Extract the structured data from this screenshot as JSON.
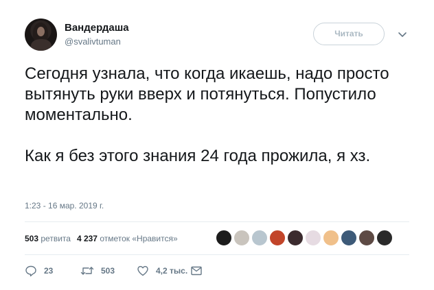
{
  "author": {
    "display_name": "Вандердаша",
    "handle": "@svalivtuman"
  },
  "follow_button": {
    "label": "Читать"
  },
  "tweet": {
    "paragraphs": [
      "Сегодня узнала, что когда икаешь, надо просто вытянуть руки вверх и потянуться. Попустило моментально.",
      "Как я без этого знания 24 года прожила, я хз."
    ],
    "timestamp": "1:23 - 16 мар. 2019 г."
  },
  "stats": {
    "retweets_count": "503",
    "retweets_label": "ретвита",
    "likes_count": "4 237",
    "likes_label": "отметок «Нравится»"
  },
  "likers": {
    "avatar_colors": [
      "#1c1c1c",
      "#c9c4bd",
      "#b8c6cf",
      "#c2452a",
      "#3b2b2e",
      "#e6dbe2",
      "#f0c08a",
      "#3d5a78",
      "#5d4a44",
      "#2a2a2a"
    ]
  },
  "actions": {
    "replies": "23",
    "retweets": "503",
    "likes": "4,2 тыс."
  },
  "colors": {
    "text": "#14171a",
    "secondary": "#657786",
    "border": "#e6ecf0"
  }
}
